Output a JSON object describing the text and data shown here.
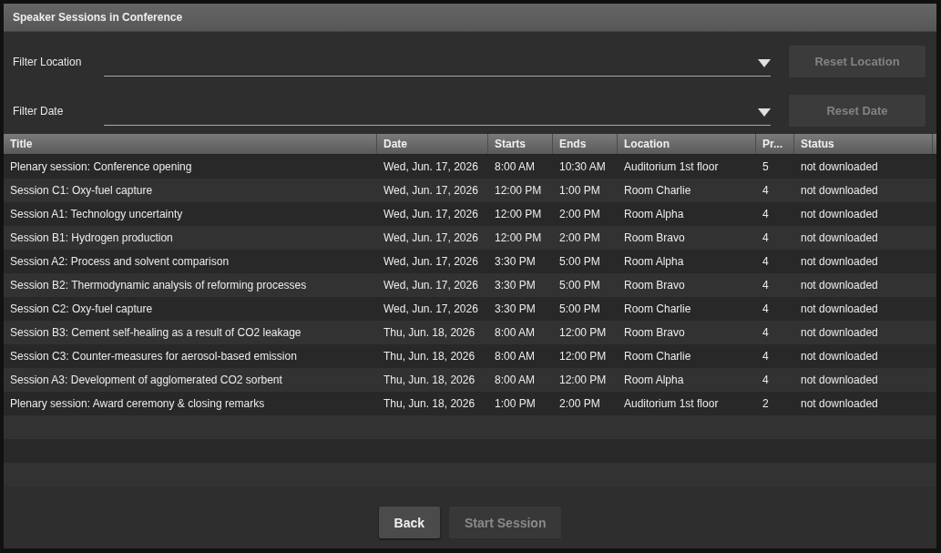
{
  "window": {
    "title": "Speaker Sessions in Conference"
  },
  "filters": [
    {
      "label": "Filter Location",
      "reset_button": {
        "label": "Reset Location",
        "disabled": true
      }
    },
    {
      "label": "Filter Date",
      "reset_button": {
        "label": "Reset Date",
        "disabled": true
      }
    }
  ],
  "table": {
    "columns": [
      "Title",
      "Date",
      "Starts",
      "Ends",
      "Location",
      "Pr...",
      "Status"
    ],
    "rows": [
      [
        "Plenary session: Conference opening",
        "Wed, Jun. 17, 2026",
        "8:00 AM",
        "10:30 AM",
        "Auditorium 1st floor",
        "5",
        "not downloaded"
      ],
      [
        "Session C1: Oxy-fuel capture",
        "Wed, Jun. 17, 2026",
        "12:00 PM",
        "1:00 PM",
        "Room Charlie",
        "4",
        "not downloaded"
      ],
      [
        "Session A1: Technology uncertainty",
        "Wed, Jun. 17, 2026",
        "12:00 PM",
        "2:00 PM",
        "Room Alpha",
        "4",
        "not downloaded"
      ],
      [
        "Session B1: Hydrogen production",
        "Wed, Jun. 17, 2026",
        "12:00 PM",
        "2:00 PM",
        "Room Bravo",
        "4",
        "not downloaded"
      ],
      [
        "Session A2: Process and solvent comparison",
        "Wed, Jun. 17, 2026",
        "3:30 PM",
        "5:00 PM",
        "Room Alpha",
        "4",
        "not downloaded"
      ],
      [
        "Session B2: Thermodynamic analysis of reforming processes",
        "Wed, Jun. 17, 2026",
        "3:30 PM",
        "5:00 PM",
        "Room Bravo",
        "4",
        "not downloaded"
      ],
      [
        "Session C2: Oxy-fuel capture",
        "Wed, Jun. 17, 2026",
        "3:30 PM",
        "5:00 PM",
        "Room Charlie",
        "4",
        "not downloaded"
      ],
      [
        "Session B3: Cement self-healing as a result of CO2 leakage",
        "Thu, Jun. 18, 2026",
        "8:00 AM",
        "12:00 PM",
        "Room Bravo",
        "4",
        "not downloaded"
      ],
      [
        "Session C3: Counter-measures for aerosol-based emission",
        "Thu, Jun. 18, 2026",
        "8:00 AM",
        "12:00 PM",
        "Room Charlie",
        "4",
        "not downloaded"
      ],
      [
        "Session A3: Development of agglomerated CO2 sorbent",
        "Thu, Jun. 18, 2026",
        "8:00 AM",
        "12:00 PM",
        "Room Alpha",
        "4",
        "not downloaded"
      ],
      [
        "Plenary session: Award ceremony & closing remarks",
        "Thu, Jun. 18, 2026",
        "1:00 PM",
        "2:00 PM",
        "Auditorium 1st floor",
        "2",
        "not downloaded"
      ]
    ]
  },
  "buttons": [
    {
      "label": "Back",
      "disabled": false
    },
    {
      "label": "Start Session",
      "disabled": true
    }
  ]
}
